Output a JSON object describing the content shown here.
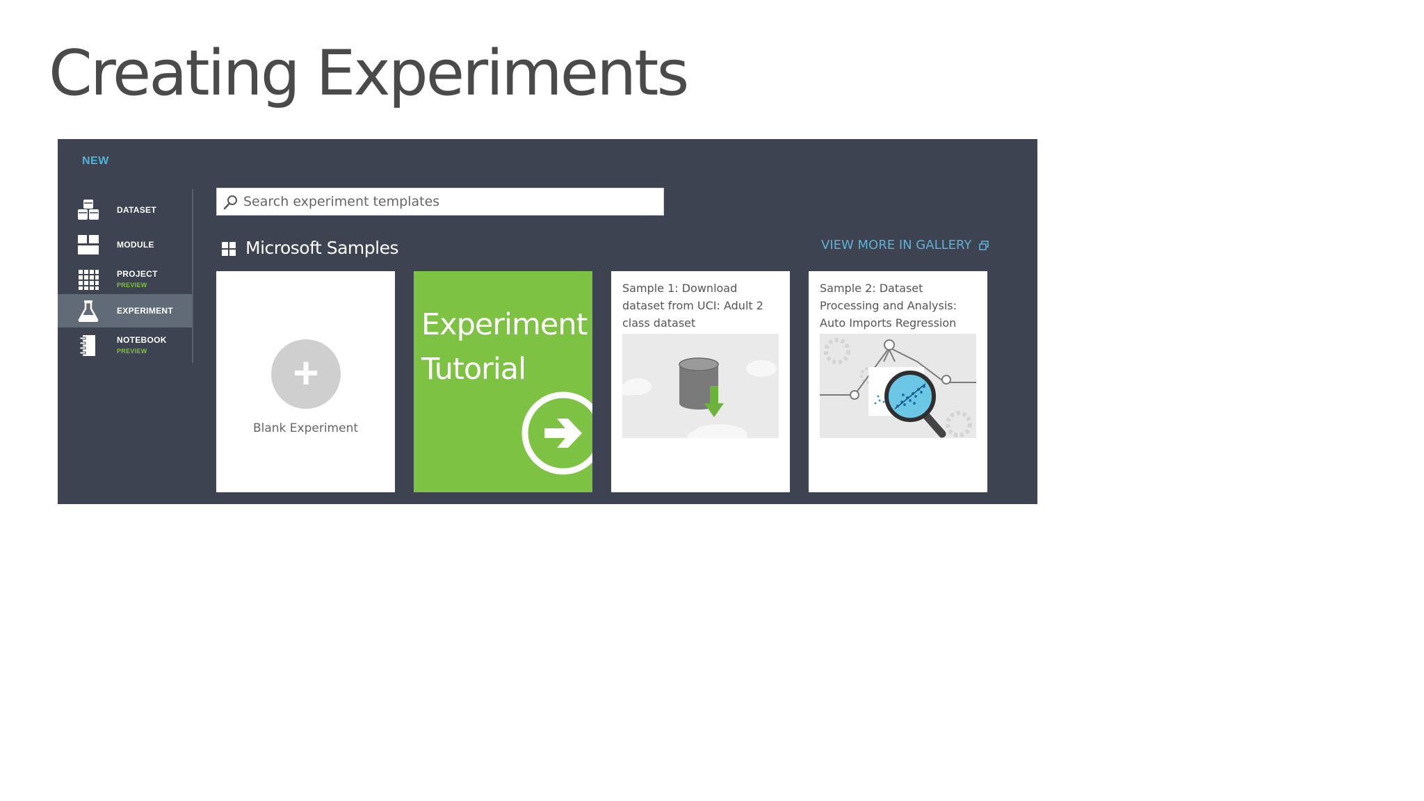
{
  "slide": {
    "title": "Creating Experiments"
  },
  "panel": {
    "new_label": "NEW",
    "sidebar": [
      {
        "label": "DATASET",
        "sub": "",
        "icon": "dataset-icon",
        "active": false
      },
      {
        "label": "MODULE",
        "sub": "",
        "icon": "module-icon",
        "active": false
      },
      {
        "label": "PROJECT",
        "sub": "PREVIEW",
        "icon": "project-icon",
        "active": false
      },
      {
        "label": "EXPERIMENT",
        "sub": "",
        "icon": "flask-icon",
        "active": true
      },
      {
        "label": "NOTEBOOK",
        "sub": "PREVIEW",
        "icon": "notebook-icon",
        "active": false
      }
    ],
    "search": {
      "placeholder": "Search experiment templates",
      "icon": "search-icon"
    },
    "section": {
      "title": "Microsoft Samples",
      "icon": "grid-icon"
    },
    "gallery_link": "VIEW MORE IN GALLERY",
    "cards": {
      "blank": {
        "label": "Blank Experiment",
        "icon": "plus-icon"
      },
      "tutorial": {
        "line1": "Experiment",
        "line2": "Tutorial",
        "icon": "arrow-right-icon"
      },
      "sample1": {
        "title": "Sample 1: Download dataset from UCI: Adult 2 class dataset"
      },
      "sample2": {
        "title": "Sample 2: Dataset Processing and Analysis: Auto Imports Regression"
      }
    }
  },
  "colors": {
    "panel_bg": "#3d4350",
    "sidebar_active": "#616a77",
    "accent_blue": "#4fb3d9",
    "preview_green": "#7ec33d",
    "tutorial_green": "#7dc242"
  }
}
